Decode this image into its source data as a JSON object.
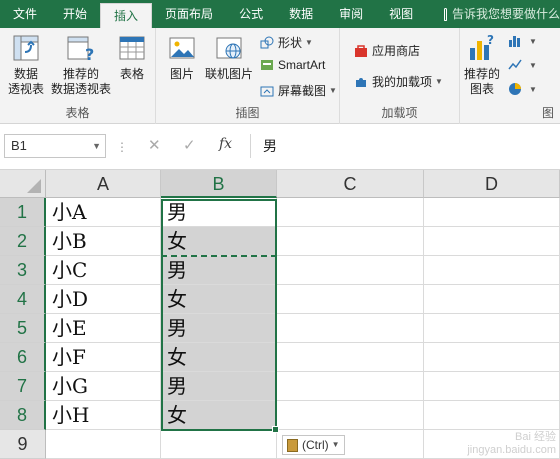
{
  "tabs": [
    "文件",
    "开始",
    "插入",
    "页面布局",
    "公式",
    "数据",
    "审阅",
    "视图"
  ],
  "active_tab": "插入",
  "tell_me": "告诉我您想要做什么",
  "ribbon": {
    "tables": {
      "group_label": "表格",
      "pivot_table": "数据\n透视表",
      "recommended_pivot": "推荐的\n数据透视表",
      "table": "表格"
    },
    "illustrations": {
      "group_label": "插图",
      "pictures": "图片",
      "online_pictures": "联机图片",
      "shapes": "形状",
      "smartart": "SmartArt",
      "screenshot": "屏幕截图"
    },
    "addins": {
      "group_label": "加载项",
      "store": "应用商店",
      "my_addins": "我的加载项"
    },
    "charts": {
      "recommended_charts": "推荐的\n图表",
      "group_label_partial": "图"
    }
  },
  "formula_bar": {
    "name_box": "B1",
    "formula": "男"
  },
  "sheet": {
    "columns": [
      "A",
      "B",
      "C",
      "D"
    ],
    "rows": [
      "1",
      "2",
      "3",
      "4",
      "5",
      "6",
      "7",
      "8",
      "9"
    ],
    "cells": [
      [
        "小A",
        "男"
      ],
      [
        "小B",
        "女"
      ],
      [
        "小C",
        "男"
      ],
      [
        "小D",
        "女"
      ],
      [
        "小E",
        "男"
      ],
      [
        "小F",
        "女"
      ],
      [
        "小G",
        "男"
      ],
      [
        "小H",
        "女"
      ],
      [
        "",
        ""
      ]
    ]
  },
  "paste_options": "(Ctrl)",
  "watermark": "Bai 经验\njingyan.baidu.com",
  "colors": {
    "accent": "#217346",
    "selection": "#d3d3d3"
  }
}
